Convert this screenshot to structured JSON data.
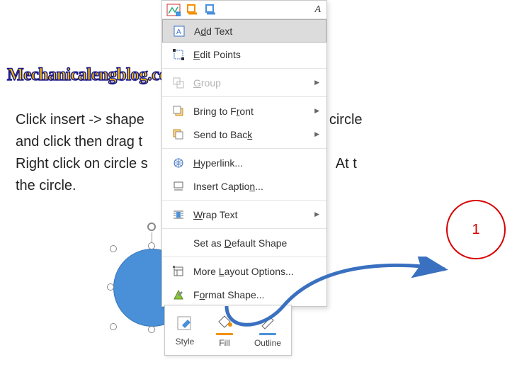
{
  "watermark": "Mechanicalengblog.com",
  "body_lines": {
    "l1a": "Click insert -> shape ",
    "l1b": "circle",
    "l2a": "and click then drag t",
    "l3a": "Right click on circle s",
    "l3b": "At t",
    "l4": "the circle."
  },
  "ctx": {
    "add_text": "Add Text",
    "edit_points": "Edit Points",
    "group": "Group",
    "bring_front": "Bring to Front",
    "send_back": "Send to Back",
    "hyperlink": "Hyperlink...",
    "insert_caption": "Insert Caption...",
    "wrap_text": "Wrap Text",
    "set_default": "Set as Default Shape",
    "more_layout": "More Layout Options...",
    "format_shape": "Format Shape..."
  },
  "mini": {
    "style": "Style",
    "fill": "Fill",
    "outline": "Outline"
  },
  "anno": {
    "label": "1"
  }
}
